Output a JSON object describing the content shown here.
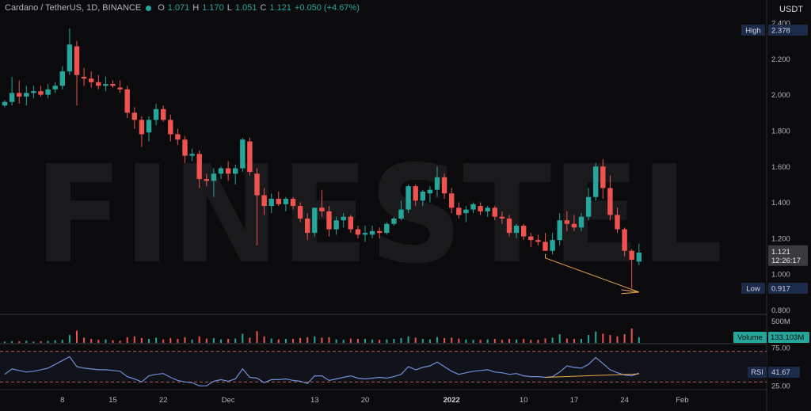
{
  "legend": {
    "symbol": "Cardano / TetherUS, 1D, BINANCE",
    "o_label": "O",
    "o_value": "1.071",
    "h_label": "H",
    "h_value": "1.170",
    "l_label": "L",
    "l_value": "1.051",
    "c_label": "C",
    "c_value": "1.121",
    "change": "+0.050 (+4.67%)"
  },
  "price_axis": {
    "currency": "USDT"
  },
  "watermark": "FINESTEL",
  "colors": {
    "up": "#26a69a",
    "down": "#ef5350",
    "rsi_line": "#6f8fd9",
    "annotation": "#f0a84a",
    "background": "#0b0b0d"
  },
  "markers": {
    "high": {
      "label": "High",
      "value": "2.378"
    },
    "low": {
      "label": "Low",
      "value": "0.917"
    },
    "last": {
      "value": "1.121",
      "countdown": "12:26:17"
    },
    "volume": {
      "label": "Volume",
      "value": "133.103M"
    },
    "rsi": {
      "label": "RSI",
      "value": "41.67"
    }
  },
  "chart_data": [
    {
      "type": "candlestick",
      "title": "Cardano / TetherUS, 1D, BINANCE",
      "ylabel": "USDT",
      "ylim": [
        0.78,
        2.44
      ],
      "yticks": [
        "2.400",
        "2.200",
        "2.000",
        "1.800",
        "1.600",
        "1.400",
        "1.200",
        "1.000",
        "0.800"
      ],
      "x_ticks": [
        {
          "i": 8,
          "label": "8"
        },
        {
          "i": 15,
          "label": "15"
        },
        {
          "i": 22,
          "label": "22"
        },
        {
          "i": 31,
          "label": "Dec"
        },
        {
          "i": 43,
          "label": "13"
        },
        {
          "i": 50,
          "label": "20"
        },
        {
          "i": 62,
          "label": "2022"
        },
        {
          "i": 72,
          "label": "10"
        },
        {
          "i": 79,
          "label": "17"
        },
        {
          "i": 86,
          "label": "24"
        },
        {
          "i": 94,
          "label": "Feb"
        }
      ],
      "candles": [
        [
          1.94,
          1.97,
          1.93,
          1.96
        ],
        [
          1.96,
          2.1,
          1.94,
          2.01
        ],
        [
          2.01,
          2.08,
          1.95,
          1.99
        ],
        [
          1.99,
          2.05,
          1.94,
          2.01
        ],
        [
          2.01,
          2.05,
          1.98,
          2.02
        ],
        [
          2.02,
          2.05,
          1.99,
          2.0
        ],
        [
          2.0,
          2.06,
          1.98,
          2.03
        ],
        [
          2.03,
          2.07,
          2.01,
          2.05
        ],
        [
          2.05,
          2.16,
          2.03,
          2.13
        ],
        [
          2.13,
          2.37,
          2.11,
          2.28
        ],
        [
          2.27,
          2.3,
          1.94,
          2.11
        ],
        [
          2.1,
          2.15,
          2.05,
          2.09
        ],
        [
          2.09,
          2.13,
          2.04,
          2.07
        ],
        [
          2.07,
          2.11,
          2.03,
          2.05
        ],
        [
          2.05,
          2.1,
          2.02,
          2.06
        ],
        [
          2.06,
          2.08,
          2.04,
          2.05
        ],
        [
          2.04,
          2.08,
          2.01,
          2.03
        ],
        [
          2.03,
          2.05,
          1.87,
          1.9
        ],
        [
          1.9,
          1.93,
          1.81,
          1.86
        ],
        [
          1.86,
          1.88,
          1.71,
          1.78
        ],
        [
          1.79,
          1.88,
          1.74,
          1.86
        ],
        [
          1.86,
          1.95,
          1.83,
          1.92
        ],
        [
          1.92,
          1.94,
          1.85,
          1.86
        ],
        [
          1.86,
          1.89,
          1.74,
          1.78
        ],
        [
          1.78,
          1.81,
          1.72,
          1.75
        ],
        [
          1.75,
          1.77,
          1.62,
          1.66
        ],
        [
          1.66,
          1.7,
          1.63,
          1.67
        ],
        [
          1.67,
          1.69,
          1.48,
          1.53
        ],
        [
          1.53,
          1.56,
          1.49,
          1.52
        ],
        [
          1.52,
          1.59,
          1.43,
          1.56
        ],
        [
          1.56,
          1.6,
          1.53,
          1.59
        ],
        [
          1.59,
          1.63,
          1.52,
          1.56
        ],
        [
          1.56,
          1.61,
          1.5,
          1.59
        ],
        [
          1.59,
          1.76,
          1.57,
          1.75
        ],
        [
          1.74,
          1.76,
          1.55,
          1.57
        ],
        [
          1.56,
          1.59,
          1.16,
          1.44
        ],
        [
          1.44,
          1.48,
          1.33,
          1.38
        ],
        [
          1.38,
          1.45,
          1.34,
          1.42
        ],
        [
          1.42,
          1.46,
          1.38,
          1.39
        ],
        [
          1.39,
          1.43,
          1.35,
          1.42
        ],
        [
          1.42,
          1.43,
          1.36,
          1.38
        ],
        [
          1.38,
          1.4,
          1.29,
          1.31
        ],
        [
          1.31,
          1.34,
          1.19,
          1.23
        ],
        [
          1.23,
          1.37,
          1.21,
          1.37
        ],
        [
          1.37,
          1.47,
          1.32,
          1.35
        ],
        [
          1.35,
          1.38,
          1.21,
          1.25
        ],
        [
          1.25,
          1.32,
          1.22,
          1.3
        ],
        [
          1.3,
          1.34,
          1.26,
          1.32
        ],
        [
          1.32,
          1.33,
          1.23,
          1.25
        ],
        [
          1.25,
          1.27,
          1.2,
          1.22
        ],
        [
          1.22,
          1.27,
          1.18,
          1.23
        ],
        [
          1.22,
          1.27,
          1.2,
          1.24
        ],
        [
          1.24,
          1.26,
          1.2,
          1.23
        ],
        [
          1.23,
          1.29,
          1.22,
          1.28
        ],
        [
          1.28,
          1.32,
          1.27,
          1.31
        ],
        [
          1.31,
          1.41,
          1.3,
          1.36
        ],
        [
          1.36,
          1.5,
          1.34,
          1.49
        ],
        [
          1.49,
          1.5,
          1.38,
          1.41
        ],
        [
          1.41,
          1.47,
          1.38,
          1.46
        ],
        [
          1.45,
          1.49,
          1.4,
          1.47
        ],
        [
          1.47,
          1.6,
          1.43,
          1.54
        ],
        [
          1.54,
          1.56,
          1.42,
          1.45
        ],
        [
          1.45,
          1.48,
          1.34,
          1.37
        ],
        [
          1.37,
          1.4,
          1.31,
          1.33
        ],
        [
          1.34,
          1.38,
          1.29,
          1.36
        ],
        [
          1.36,
          1.4,
          1.34,
          1.39
        ],
        [
          1.38,
          1.4,
          1.33,
          1.35
        ],
        [
          1.35,
          1.38,
          1.32,
          1.37
        ],
        [
          1.37,
          1.38,
          1.3,
          1.32
        ],
        [
          1.32,
          1.35,
          1.28,
          1.31
        ],
        [
          1.31,
          1.33,
          1.21,
          1.23
        ],
        [
          1.23,
          1.28,
          1.2,
          1.27
        ],
        [
          1.27,
          1.28,
          1.19,
          1.21
        ],
        [
          1.21,
          1.23,
          1.15,
          1.19
        ],
        [
          1.19,
          1.22,
          1.16,
          1.18
        ],
        [
          1.18,
          1.23,
          1.13,
          1.13
        ],
        [
          1.13,
          1.23,
          1.11,
          1.19
        ],
        [
          1.19,
          1.34,
          1.16,
          1.3
        ],
        [
          1.3,
          1.35,
          1.24,
          1.28
        ],
        [
          1.28,
          1.33,
          1.24,
          1.26
        ],
        [
          1.26,
          1.34,
          1.24,
          1.32
        ],
        [
          1.32,
          1.48,
          1.3,
          1.43
        ],
        [
          1.43,
          1.62,
          1.41,
          1.6
        ],
        [
          1.6,
          1.64,
          1.42,
          1.48
        ],
        [
          1.48,
          1.55,
          1.3,
          1.33
        ],
        [
          1.33,
          1.37,
          1.23,
          1.25
        ],
        [
          1.25,
          1.26,
          1.1,
          1.13
        ],
        [
          1.13,
          1.14,
          0.92,
          1.08
        ],
        [
          1.07,
          1.17,
          1.05,
          1.12
        ]
      ]
    },
    {
      "type": "bar",
      "series": [
        {
          "name": "Volume"
        }
      ],
      "ylim": [
        0,
        600
      ],
      "yticks": [
        "500M"
      ],
      "values": [
        30,
        40,
        35,
        50,
        30,
        40,
        45,
        60,
        70,
        180,
        280,
        120,
        90,
        70,
        80,
        60,
        50,
        130,
        150,
        110,
        90,
        120,
        80,
        110,
        90,
        130,
        80,
        150,
        100,
        110,
        80,
        90,
        100,
        210,
        120,
        270,
        150,
        100,
        80,
        90,
        90,
        110,
        130,
        150,
        120,
        130,
        80,
        70,
        100,
        90,
        90,
        80,
        70,
        80,
        90,
        110,
        150,
        120,
        90,
        80,
        130,
        110,
        120,
        100,
        80,
        70,
        70,
        80,
        90,
        70,
        90,
        80,
        90,
        70,
        70,
        100,
        120,
        200,
        100,
        90,
        90,
        180,
        260,
        210,
        180,
        150,
        200,
        330,
        130
      ]
    },
    {
      "type": "line",
      "series": [
        {
          "name": "RSI"
        }
      ],
      "ylim": [
        20,
        80
      ],
      "yticks": [
        "75.00",
        "25.00"
      ],
      "values": [
        40,
        47,
        45,
        43,
        44,
        46,
        48,
        53,
        58,
        63,
        50,
        48,
        47,
        46,
        46,
        45,
        44,
        37,
        34,
        30,
        38,
        40,
        41,
        36,
        32,
        30,
        29,
        25,
        25,
        31,
        33,
        31,
        34,
        47,
        36,
        35,
        29,
        33,
        33,
        34,
        32,
        31,
        28,
        38,
        38,
        32,
        34,
        36,
        38,
        35,
        34,
        35,
        36,
        35,
        37,
        40,
        50,
        46,
        49,
        51,
        56,
        50,
        44,
        40,
        42,
        44,
        45,
        46,
        43,
        42,
        40,
        41,
        38,
        37,
        37,
        36,
        37,
        43,
        51,
        49,
        48,
        53,
        62,
        54,
        46,
        42,
        39,
        38,
        41.67
      ]
    }
  ]
}
